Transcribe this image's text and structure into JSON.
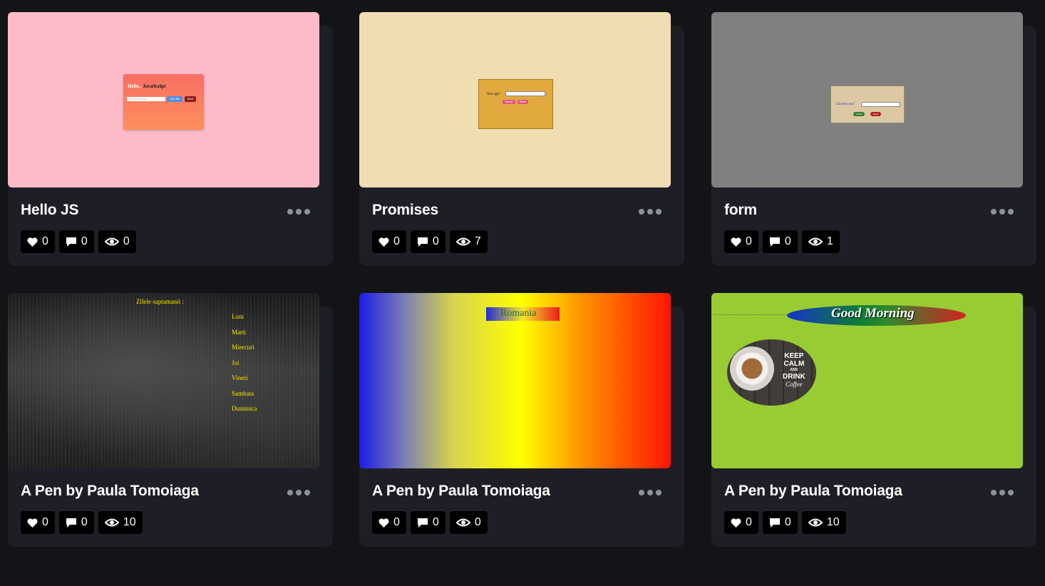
{
  "cards": [
    {
      "title": "Hello JS",
      "stats": {
        "likes": "0",
        "comments": "0",
        "views": "0"
      },
      "preview": {
        "hello_white": "Hello ,",
        "hello_black": "JavaScript",
        "input_placeholder": "Enter your first name",
        "button1": "Click Me",
        "button2": "Reset",
        "background": "#fdbbc8"
      }
    },
    {
      "title": "Promises",
      "stats": {
        "likes": "0",
        "comments": "0",
        "views": "7"
      },
      "preview": {
        "label": "Your age?",
        "button1": "Submit",
        "button2": "Reset",
        "background": "#f0ddb1"
      }
    },
    {
      "title": "form",
      "stats": {
        "likes": "0",
        "comments": "0",
        "views": "1"
      },
      "preview": {
        "label": "Cat este ora?",
        "button1": "Submit",
        "button2": "Reset",
        "background": "#808080"
      }
    },
    {
      "title": "A Pen by Paula Tomoiaga",
      "stats": {
        "likes": "0",
        "comments": "0",
        "views": "10"
      },
      "preview": {
        "heading": "Zilele saptamanii :",
        "days": [
          "Luni",
          "Marti",
          "Miercuri",
          "Joi",
          "Vineri",
          "Sambata",
          "Duminica"
        ]
      }
    },
    {
      "title": "A Pen by Paula Tomoiaga",
      "stats": {
        "likes": "0",
        "comments": "0",
        "views": "0"
      },
      "preview": {
        "flag_text": "Romania"
      }
    },
    {
      "title": "A Pen by Paula Tomoiaga",
      "stats": {
        "likes": "0",
        "comments": "0",
        "views": "10"
      },
      "preview": {
        "banner_text": "Good Morning",
        "sign_lines": [
          "KEEP",
          "CALM",
          "AND",
          "DRINK",
          "Coffee"
        ],
        "background": "#99cc33"
      }
    }
  ],
  "icons": {
    "like": "heart-icon",
    "comment": "comment-icon",
    "view": "eye-icon",
    "more": "more-dots-icon"
  }
}
